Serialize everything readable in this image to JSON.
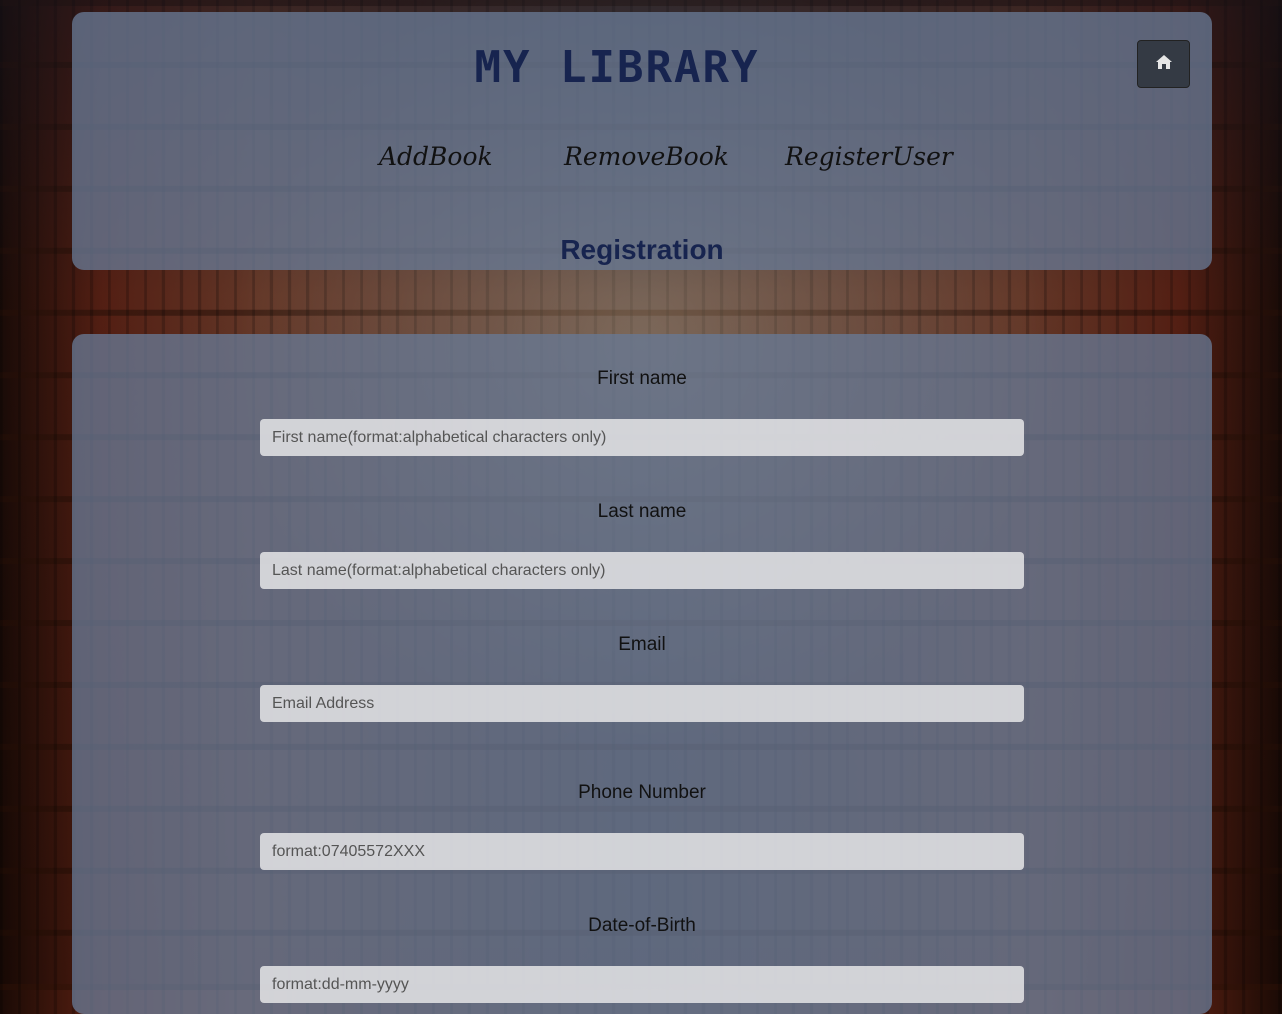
{
  "header": {
    "title": "MY LIBRARY",
    "home_icon": "home-icon",
    "nav": [
      {
        "label": "AddBook"
      },
      {
        "label": "RemoveBook"
      },
      {
        "label": "RegisterUser"
      }
    ],
    "section_title": "Registration"
  },
  "form": {
    "fields": [
      {
        "label": "First name",
        "placeholder": "First name(format:alphabetical characters only)",
        "value": ""
      },
      {
        "label": "Last name",
        "placeholder": "Last name(format:alphabetical characters only)",
        "value": ""
      },
      {
        "label": "Email",
        "placeholder": "Email Address",
        "value": ""
      },
      {
        "label": "Phone Number",
        "placeholder": "format:07405572XXX",
        "value": ""
      },
      {
        "label": "Date-of-Birth",
        "placeholder": "format:dd-mm-yyyy",
        "value": ""
      }
    ]
  },
  "colors": {
    "title": "#17244f",
    "panel": "#687994",
    "home_button": "#343a44"
  }
}
